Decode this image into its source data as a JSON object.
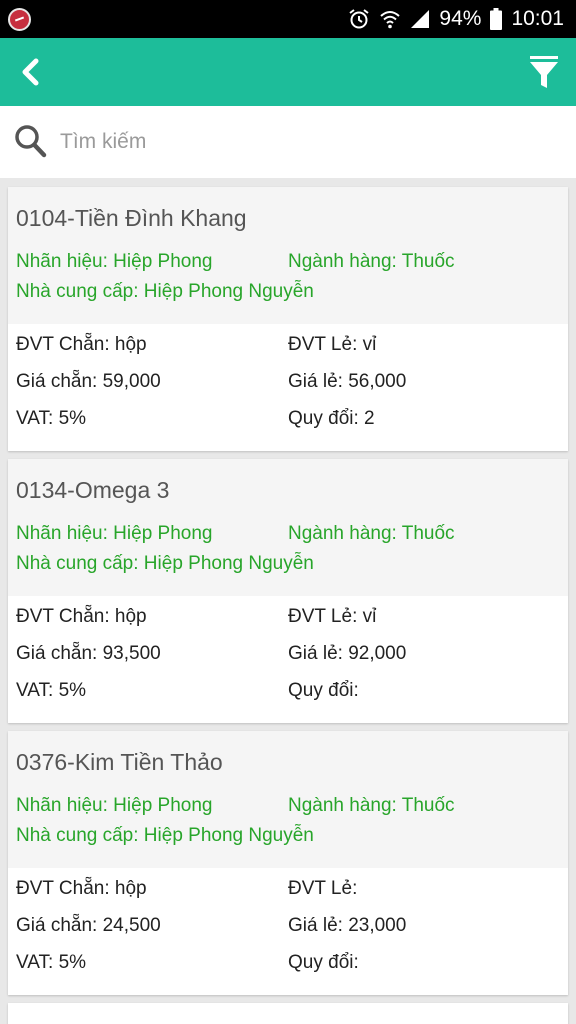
{
  "status": {
    "battery": "94%",
    "time": "10:01"
  },
  "search": {
    "placeholder": "Tìm kiếm"
  },
  "products": [
    {
      "title": "0104-Tiền Đình Khang",
      "brand": "Nhãn hiệu: Hiệp Phong",
      "category": "Ngành hàng: Thuốc",
      "supplier": "Nhà cung cấp: Hiệp Phong Nguyễn",
      "unit_whole": "ĐVT Chẵn: hộp",
      "unit_retail": "ĐVT Lẻ: vỉ",
      "price_whole": "Giá chẵn: 59,000",
      "price_retail": "Giá lẻ: 56,000",
      "vat": "VAT: 5%",
      "conversion": "Quy đổi: 2"
    },
    {
      "title": "0134-Omega 3",
      "brand": "Nhãn hiệu: Hiệp Phong",
      "category": "Ngành hàng: Thuốc",
      "supplier": "Nhà cung cấp: Hiệp Phong Nguyễn",
      "unit_whole": "ĐVT Chẵn: hộp",
      "unit_retail": "ĐVT Lẻ: vỉ",
      "price_whole": "Giá chẵn: 93,500",
      "price_retail": "Giá lẻ: 92,000",
      "vat": "VAT: 5%",
      "conversion": "Quy đổi:"
    },
    {
      "title": "0376-Kim Tiền Thảo",
      "brand": "Nhãn hiệu: Hiệp Phong",
      "category": "Ngành hàng: Thuốc",
      "supplier": "Nhà cung cấp: Hiệp Phong Nguyễn",
      "unit_whole": "ĐVT Chẵn: hộp",
      "unit_retail": "ĐVT Lẻ:",
      "price_whole": "Giá chẵn: 24,500",
      "price_retail": "Giá lẻ: 23,000",
      "vat": "VAT: 5%",
      "conversion": "Quy đổi:"
    }
  ],
  "colors": {
    "appbar": "#1dbd9a",
    "accent_text": "#28a52a"
  },
  "icons": {
    "back": "chevron-left-icon",
    "filter": "filter-icon",
    "search": "search-icon"
  }
}
